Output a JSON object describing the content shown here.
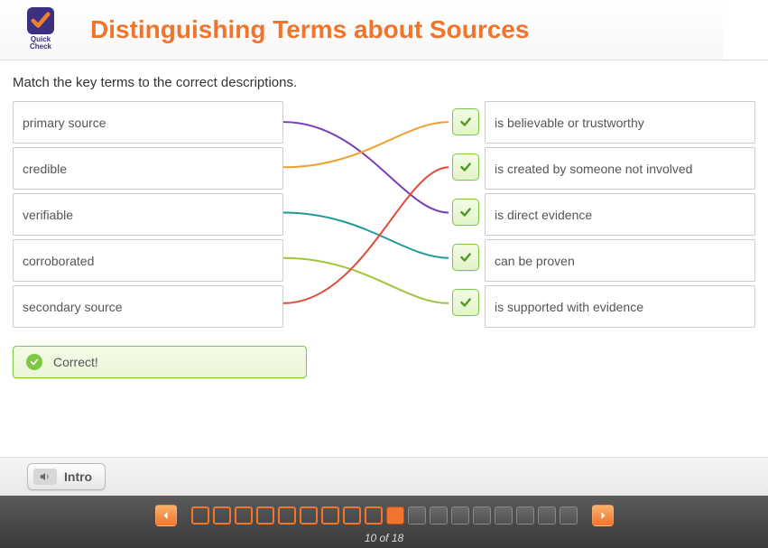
{
  "header": {
    "quickcheck_label": "Quick\nCheck",
    "title": "Distinguishing Terms about Sources"
  },
  "instruction": "Match the key terms to the correct descriptions.",
  "matching": {
    "left_terms": [
      "primary source",
      "credible",
      "verifiable",
      "corroborated",
      "secondary source"
    ],
    "right_descriptions": [
      "is believable or trustworthy",
      "is created by someone not involved",
      "is direct evidence",
      "can be proven",
      "is supported with evidence"
    ],
    "connections": [
      {
        "from": 0,
        "to": 2,
        "color": "#7b3db8"
      },
      {
        "from": 1,
        "to": 0,
        "color": "#f0a030"
      },
      {
        "from": 2,
        "to": 3,
        "color": "#1f9b98"
      },
      {
        "from": 3,
        "to": 4,
        "color": "#9fc63b"
      },
      {
        "from": 4,
        "to": 1,
        "color": "#e04a3a"
      }
    ],
    "all_correct": true
  },
  "feedback": {
    "text": "Correct!"
  },
  "intro_button": {
    "label": "Intro"
  },
  "pagination": {
    "current": 10,
    "total": 18,
    "counter_text": "10 of 18",
    "pages": [
      {
        "state": "done"
      },
      {
        "state": "done"
      },
      {
        "state": "done"
      },
      {
        "state": "done"
      },
      {
        "state": "done"
      },
      {
        "state": "done"
      },
      {
        "state": "done"
      },
      {
        "state": "done"
      },
      {
        "state": "done"
      },
      {
        "state": "current"
      },
      {
        "state": "future"
      },
      {
        "state": "future"
      },
      {
        "state": "future"
      },
      {
        "state": "future"
      },
      {
        "state": "future"
      },
      {
        "state": "future"
      },
      {
        "state": "future"
      },
      {
        "state": "future"
      }
    ]
  }
}
